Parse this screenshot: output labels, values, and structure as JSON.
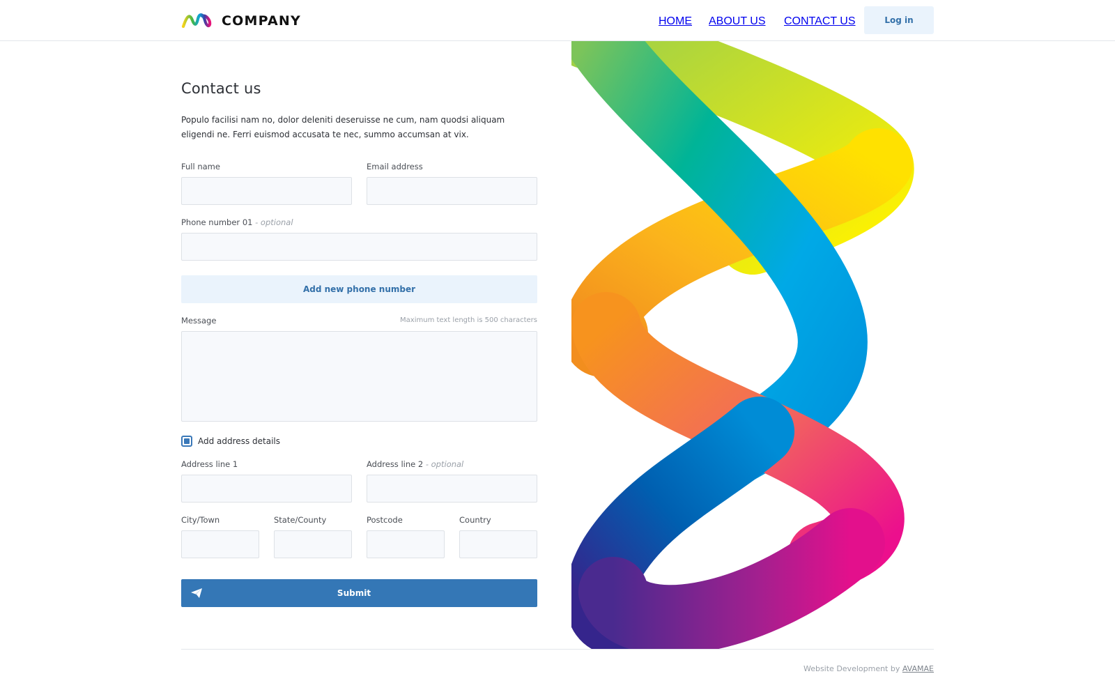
{
  "brand": {
    "name": "COMPANY",
    "logo_icon": "multicolor-ribbon-logo"
  },
  "nav": {
    "items": [
      "HOME",
      "ABOUT US",
      "CONTACT US"
    ],
    "login_label": "Log in"
  },
  "page": {
    "title": "Contact us",
    "intro": "Populo facilisi nam no, dolor deleniti deseruisse ne cum, nam quodsi aliquam eligendi ne. Ferri euismod accusata te nec, summo accumsan at vix."
  },
  "form": {
    "full_name_label": "Full name",
    "email_label": "Email address",
    "phone_label": "Phone number 01",
    "optional_suffix": "- optional",
    "add_phone_label": "Add new phone number",
    "message_label": "Message",
    "message_hint": "Maximum text length is 500 characters",
    "address_checkbox_label": "Add address details",
    "address_checked": true,
    "address1_label": "Address line 1",
    "address2_label": "Address line 2",
    "city_label": "City/Town",
    "state_label": "State/County",
    "postcode_label": "Postcode",
    "country_label": "Country",
    "submit_label": "Submit",
    "submit_icon": "paper-plane-icon"
  },
  "footer": {
    "credit_prefix": "Website Development by",
    "credit_link": "AVAMAE"
  },
  "colors": {
    "primary": "#3477b6",
    "light_button": "#eaf3fc",
    "field_bg": "#f7f9fc"
  }
}
